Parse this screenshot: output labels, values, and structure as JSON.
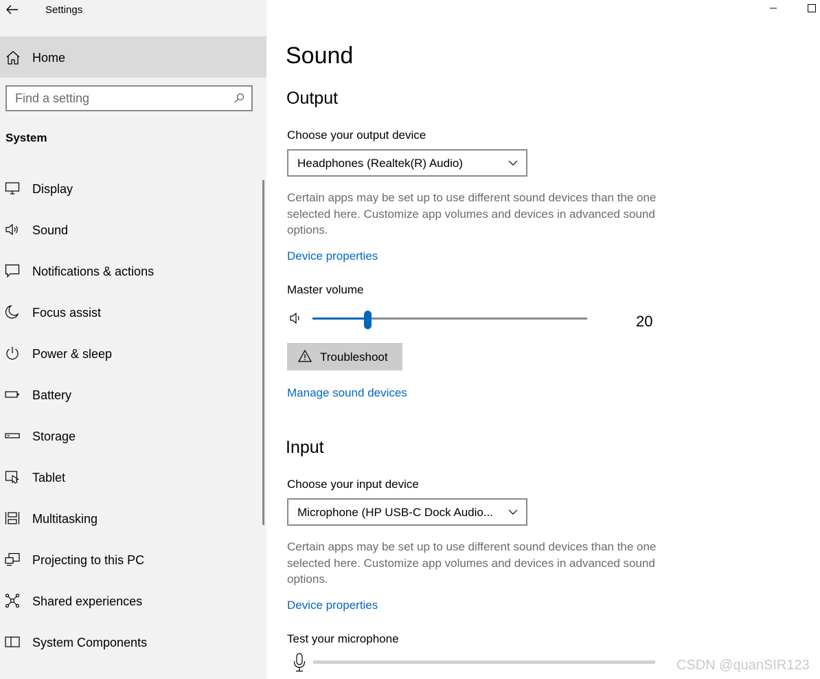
{
  "window": {
    "title": "Settings",
    "minimize_glyph": "—",
    "maximize_glyph": "☐"
  },
  "sidebar": {
    "home_label": "Home",
    "search": {
      "placeholder": "Find a setting",
      "value": ""
    },
    "section": "System",
    "items": [
      {
        "label": "Display",
        "icon": "monitor-icon"
      },
      {
        "label": "Sound",
        "icon": "speaker-icon"
      },
      {
        "label": "Notifications & actions",
        "icon": "notifications-icon"
      },
      {
        "label": "Focus assist",
        "icon": "moon-icon"
      },
      {
        "label": "Power & sleep",
        "icon": "power-icon"
      },
      {
        "label": "Battery",
        "icon": "battery-icon"
      },
      {
        "label": "Storage",
        "icon": "storage-icon"
      },
      {
        "label": "Tablet",
        "icon": "tablet-icon"
      },
      {
        "label": "Multitasking",
        "icon": "multitasking-icon"
      },
      {
        "label": "Projecting to this PC",
        "icon": "projecting-icon"
      },
      {
        "label": "Shared experiences",
        "icon": "shared-icon"
      },
      {
        "label": "System Components",
        "icon": "components-icon"
      }
    ]
  },
  "main": {
    "title": "Sound",
    "output": {
      "heading": "Output",
      "device_label": "Choose your output device",
      "device_value": "Headphones (Realtek(R) Audio)",
      "description": "Certain apps may be set up to use different sound devices than the one selected here. Customize app volumes and devices in advanced sound options.",
      "device_properties_link": "Device properties",
      "master_volume_label": "Master volume",
      "master_volume_value": "20",
      "master_volume_fraction": 0.2,
      "troubleshoot_label": "Troubleshoot",
      "manage_link": "Manage sound devices"
    },
    "input": {
      "heading": "Input",
      "device_label": "Choose your input device",
      "device_value": "Microphone (HP USB-C Dock Audio...",
      "description": "Certain apps may be set up to use different sound devices than the one selected here. Customize app volumes and devices in advanced sound options.",
      "device_properties_link": "Device properties",
      "test_label": "Test your microphone",
      "mic_level_fraction": 0
    }
  },
  "watermark": "CSDN @quanSIR123",
  "colors": {
    "accent": "#0067c0",
    "sidebar_bg": "#f2f2f2",
    "selected_bg": "#dadada",
    "desc_text": "#6b6b6b"
  }
}
